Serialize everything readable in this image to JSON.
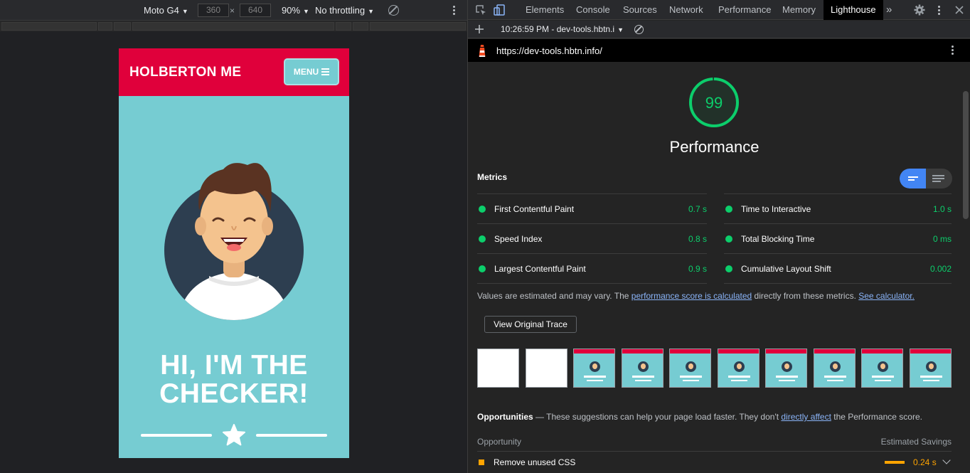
{
  "device_toolbar": {
    "device": "Moto G4",
    "width": "360",
    "height": "640",
    "times": "×",
    "zoom": "90%",
    "throttling": "No throttling"
  },
  "site": {
    "brand": "HOLBERTON ME",
    "menu_label": "MENU",
    "hero_line1": "HI, I'M THE",
    "hero_line2": "CHECKER!",
    "colors": {
      "header": "#e0003b",
      "body": "#76ccd2"
    }
  },
  "devtools": {
    "tabs": [
      "Elements",
      "Console",
      "Sources",
      "Network",
      "Performance",
      "Memory",
      "Lighthouse"
    ],
    "active_tab": "Lighthouse",
    "more_tabs": "»",
    "report_selector": "10:26:59 PM - dev-tools.hbtn.i",
    "url": "https://dev-tools.hbtn.info/"
  },
  "lighthouse": {
    "score": "99",
    "score_fraction": 0.99,
    "category": "Performance",
    "metrics_heading": "Metrics",
    "metrics": [
      {
        "label": "First Contentful Paint",
        "value": "0.7 s"
      },
      {
        "label": "Time to Interactive",
        "value": "1.0 s"
      },
      {
        "label": "Speed Index",
        "value": "0.8 s"
      },
      {
        "label": "Total Blocking Time",
        "value": "0 ms"
      },
      {
        "label": "Largest Contentful Paint",
        "value": "0.9 s"
      },
      {
        "label": "Cumulative Layout Shift",
        "value": "0.002"
      }
    ],
    "note_pre": "Values are estimated and may vary. The ",
    "note_link1": "performance score is calculated",
    "note_mid": " directly from these metrics. ",
    "note_link2": "See calculator.",
    "trace_button": "View Original Trace",
    "opportunities_title": "Opportunities",
    "opportunities_desc_pre": " — These suggestions can help your page load faster. They don't ",
    "opportunities_link": "directly affect",
    "opportunities_desc_post": " the Performance score.",
    "col_opportunity": "Opportunity",
    "col_savings": "Estimated Savings",
    "opportunity_rows": [
      {
        "label": "Remove unused CSS",
        "value": "0.24 s"
      }
    ],
    "colors": {
      "pass": "#0cce6b",
      "average": "#ffa400",
      "link": "#8ab4f8"
    }
  }
}
